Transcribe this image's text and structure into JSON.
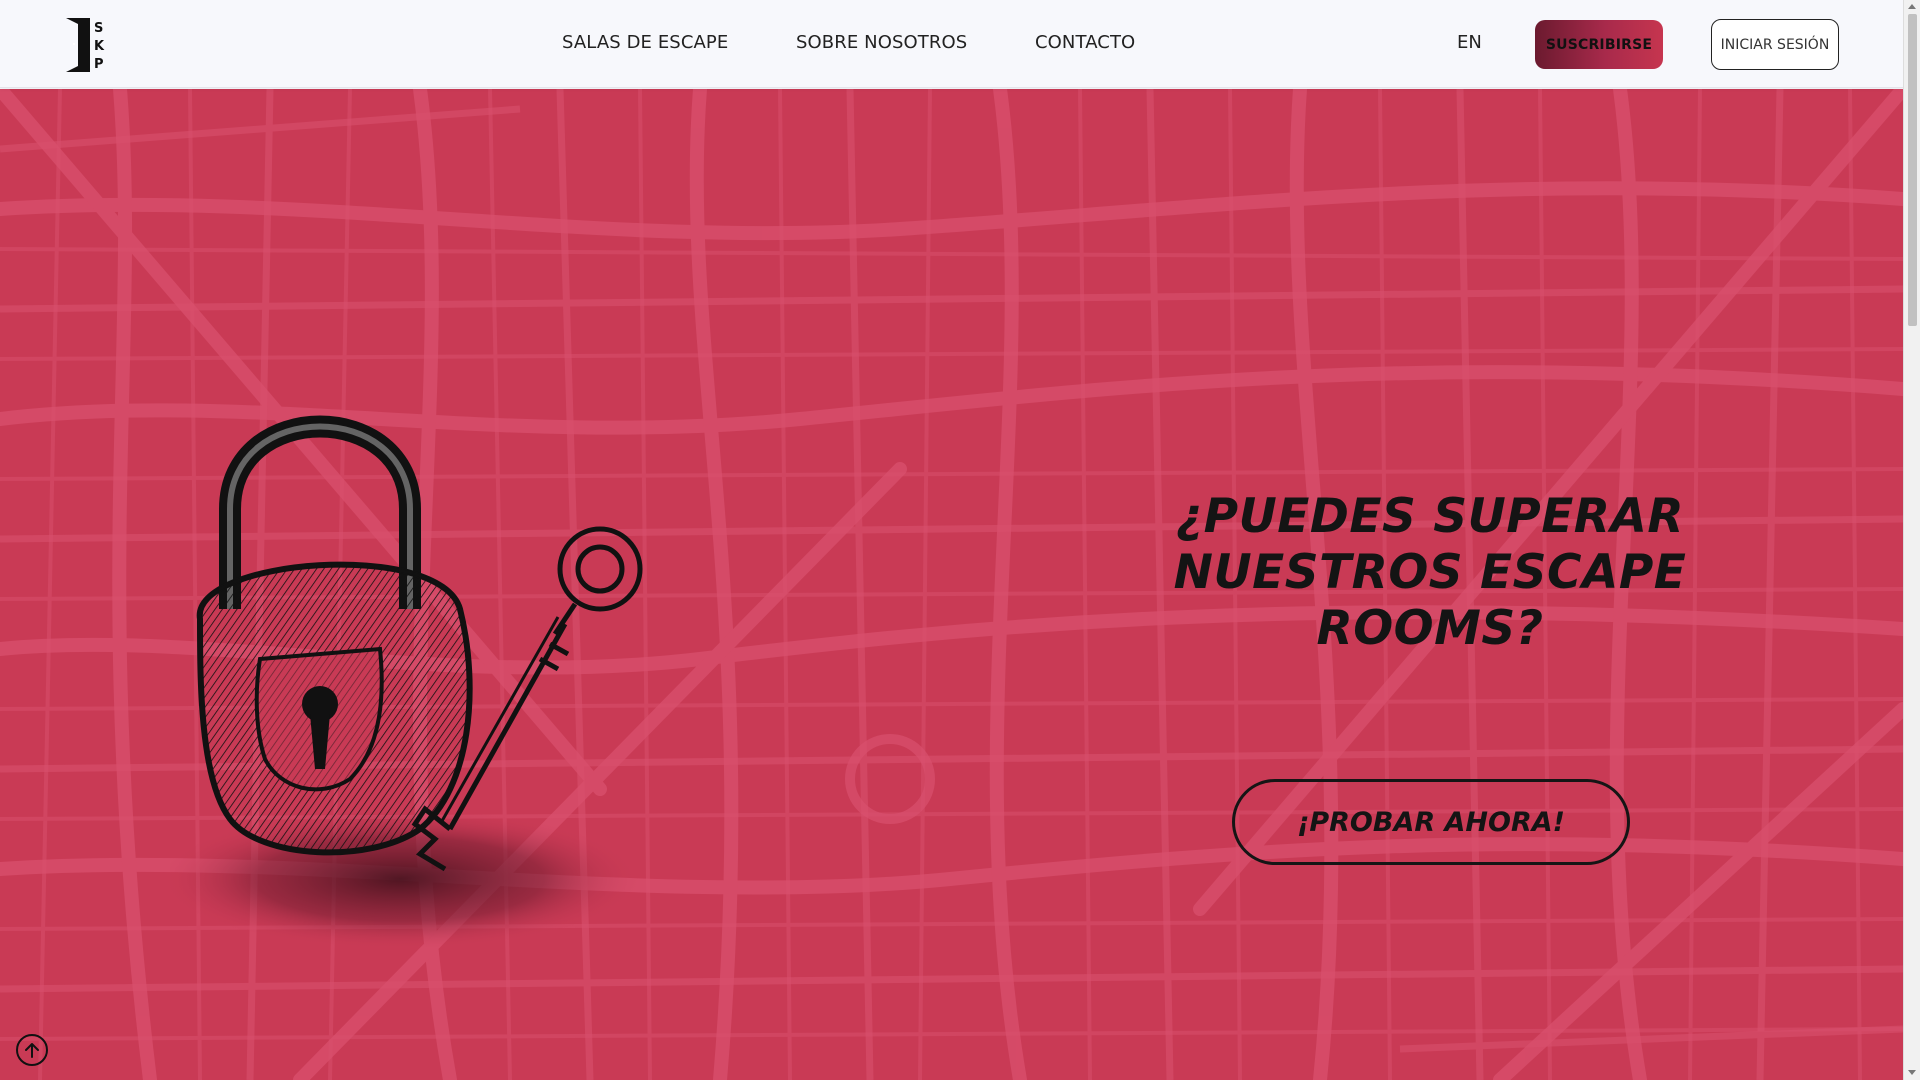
{
  "header": {
    "logo_letters": "SKP",
    "nav": [
      {
        "label": "SALAS DE ESCAPE"
      },
      {
        "label": "SOBRE NOSOTROS"
      },
      {
        "label": "CONTACTO"
      }
    ],
    "language": "EN",
    "subscribe_label": "SUSCRIBIRSE",
    "login_label": "INICIAR SESIÓN"
  },
  "hero": {
    "headline_line1": "¿PUEDES SUPERAR",
    "headline_line2": "NUESTROS ESCAPE",
    "headline_line3": "ROOMS?",
    "cta_label": "¡PROBAR AHORA!",
    "background_color": "#c93a55"
  },
  "icons": {
    "logo": "door-logo-icon",
    "lock_illustration": "padlock-and-key-illustration",
    "scroll_top": "arrow-up-circle-icon"
  }
}
